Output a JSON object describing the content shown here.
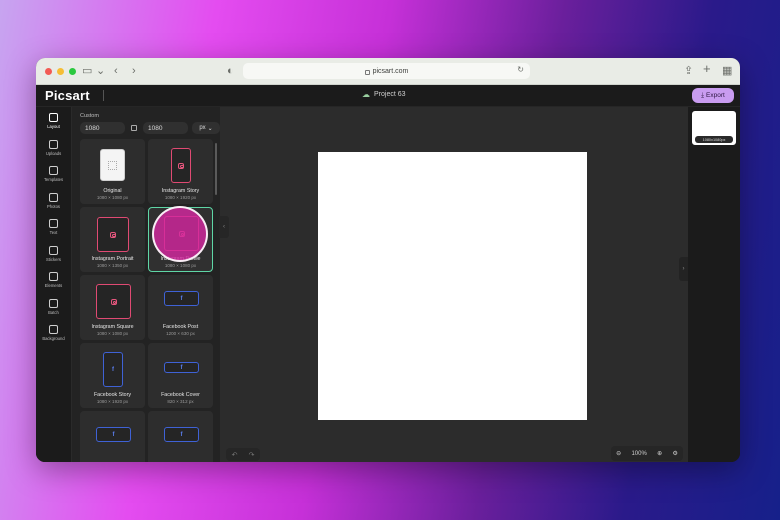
{
  "browser": {
    "url": "picsart.com"
  },
  "header": {
    "logo": "Picsart",
    "project_name": "Project 63",
    "export_label": "Export"
  },
  "rail": [
    {
      "label": "Layout",
      "icon": "layout-icon"
    },
    {
      "label": "Uploads",
      "icon": "upload-icon"
    },
    {
      "label": "Templates",
      "icon": "templates-icon"
    },
    {
      "label": "Photos",
      "icon": "photos-icon"
    },
    {
      "label": "Text",
      "icon": "text-icon"
    },
    {
      "label": "Stickers",
      "icon": "stickers-icon"
    },
    {
      "label": "Elements",
      "icon": "elements-icon"
    },
    {
      "label": "Batch",
      "icon": "batch-icon"
    },
    {
      "label": "Background",
      "icon": "background-icon"
    }
  ],
  "panel": {
    "custom_label": "Custom",
    "width": "1080",
    "height": "1080",
    "unit": "px",
    "cards": [
      {
        "name": "Original",
        "dim": "1080 × 1080 px",
        "type": "original"
      },
      {
        "name": "Instagram Story",
        "dim": "1080 × 1920 px",
        "type": "ig"
      },
      {
        "name": "Instagram Portrait",
        "dim": "1080 × 1350 px",
        "type": "ig"
      },
      {
        "name": "Instagram Profile",
        "dim": "1080 × 1080 px",
        "type": "ig"
      },
      {
        "name": "Instagram Square",
        "dim": "1080 × 1080 px",
        "type": "ig"
      },
      {
        "name": "Facebook Post",
        "dim": "1200 × 630 px",
        "type": "fb"
      },
      {
        "name": "Facebook Story",
        "dim": "1080 × 1920 px",
        "type": "fb"
      },
      {
        "name": "Facebook Cover",
        "dim": "820 × 312 px",
        "type": "fb"
      },
      {
        "name": "",
        "dim": "",
        "type": "fb"
      },
      {
        "name": "",
        "dim": "",
        "type": "fb"
      }
    ]
  },
  "zoom": {
    "level": "100%"
  },
  "pages": {
    "tag": "1080x1080px"
  },
  "colors": {
    "accent": "#c99cf0",
    "selected": "#5fd6a6",
    "instagram": "#e04a73",
    "facebook": "#3f62d6"
  }
}
